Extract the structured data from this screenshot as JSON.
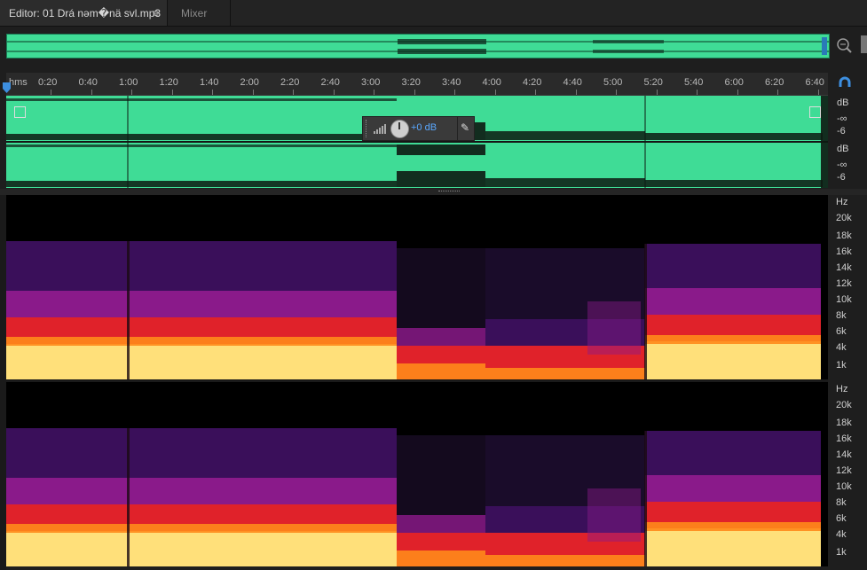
{
  "tabs": {
    "editor_label": "Editor: 01 Drá nəm�nä sᴠl.mp3",
    "menu_icon": "≡",
    "mixer_label": "Mixer"
  },
  "ruler": {
    "unit": "hms",
    "labels": [
      "0:20",
      "0:40",
      "1:00",
      "1:20",
      "1:40",
      "2:00",
      "2:20",
      "2:40",
      "3:00",
      "3:20",
      "3:40",
      "4:00",
      "4:20",
      "4:40",
      "5:00",
      "5:20",
      "5:40",
      "6:00",
      "6:20",
      "6:40"
    ]
  },
  "waveform": {
    "color": "#3fdc96",
    "scale_top": [
      "dB",
      "-∞",
      "-6"
    ],
    "scale_bottom": [
      "dB",
      "-∞",
      "-6"
    ]
  },
  "hud": {
    "value": "+0 dB",
    "pin_icon": "pin-icon"
  },
  "spectrogram": {
    "scale_labels": [
      "Hz",
      "20k",
      "18k",
      "16k",
      "14k",
      "12k",
      "10k",
      "8k",
      "6k",
      "4k",
      "1k"
    ],
    "colors": [
      "#000000",
      "#3a0f5a",
      "#8a1a8a",
      "#e0222a",
      "#ff8a1a",
      "#ffe07a"
    ]
  },
  "icons": {
    "zoom": "zoom-icon",
    "snap": "snap-icon",
    "playhead": "playhead-marker"
  }
}
